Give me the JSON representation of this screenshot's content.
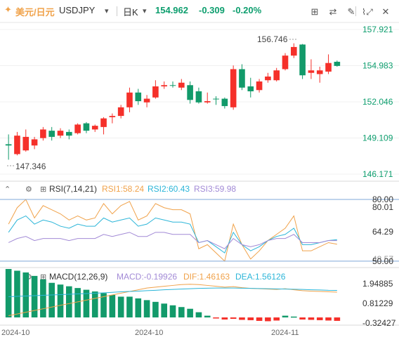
{
  "header": {
    "symbol_cn": "美元/日元",
    "symbol": "USDJPY",
    "symbol_caret": "▾",
    "period": "日K",
    "period_caret": "▾",
    "price": "154.962",
    "change": "-0.309",
    "change_pct": "-0.20%",
    "icons": [
      "draw-icon",
      "compare-icon",
      "pen-icon",
      "brush-icon",
      "expand-icon",
      "close-icon"
    ]
  },
  "colors": {
    "up": "#f5302a",
    "down": "#129a6a",
    "price_axis": "#0d9e6e",
    "rsi1": "#f0a24a",
    "rsi2": "#2bb5d8",
    "rsi3": "#a28ad6",
    "macd": "#f0a24a",
    "dea": "#2bb5d8",
    "ref_line": "#7fa8d8"
  },
  "chart_data": [
    {
      "type": "candlestick",
      "title": "",
      "y_ticks": [
        "157.921",
        "154.983",
        "152.046",
        "149.109",
        "146.171"
      ],
      "ylim": [
        146.171,
        157.921
      ],
      "high_label": "156.746",
      "low_label": "147.346",
      "candles": [
        {
          "o": 148.6,
          "h": 149.4,
          "l": 147.346,
          "c": 148.5
        },
        {
          "o": 147.8,
          "h": 149.6,
          "l": 147.7,
          "c": 149.3
        },
        {
          "o": 148.1,
          "h": 149.8,
          "l": 148.0,
          "c": 149.2
        },
        {
          "o": 148.5,
          "h": 149.2,
          "l": 148.2,
          "c": 149.0
        },
        {
          "o": 149.1,
          "h": 150.0,
          "l": 148.9,
          "c": 149.8
        },
        {
          "o": 149.7,
          "h": 150.0,
          "l": 148.9,
          "c": 149.2
        },
        {
          "o": 149.3,
          "h": 149.9,
          "l": 149.1,
          "c": 149.7
        },
        {
          "o": 149.6,
          "h": 149.8,
          "l": 149.0,
          "c": 149.3
        },
        {
          "o": 149.5,
          "h": 150.3,
          "l": 149.4,
          "c": 150.2
        },
        {
          "o": 150.3,
          "h": 150.4,
          "l": 149.5,
          "c": 149.7
        },
        {
          "o": 149.8,
          "h": 150.2,
          "l": 149.6,
          "c": 150.1
        },
        {
          "o": 150.0,
          "h": 150.8,
          "l": 149.4,
          "c": 150.7
        },
        {
          "o": 150.8,
          "h": 151.1,
          "l": 150.3,
          "c": 150.9
        },
        {
          "o": 150.9,
          "h": 151.8,
          "l": 150.7,
          "c": 151.6
        },
        {
          "o": 151.6,
          "h": 153.2,
          "l": 151.2,
          "c": 152.8
        },
        {
          "o": 152.8,
          "h": 153.1,
          "l": 151.8,
          "c": 152.1
        },
        {
          "o": 152.0,
          "h": 152.6,
          "l": 151.6,
          "c": 152.3
        },
        {
          "o": 152.4,
          "h": 153.8,
          "l": 152.3,
          "c": 153.3
        },
        {
          "o": 153.3,
          "h": 153.7,
          "l": 153.1,
          "c": 153.4
        },
        {
          "o": 153.4,
          "h": 153.7,
          "l": 153.2,
          "c": 153.35
        },
        {
          "o": 153.2,
          "h": 153.9,
          "l": 153.0,
          "c": 153.6
        },
        {
          "o": 153.4,
          "h": 153.7,
          "l": 151.9,
          "c": 152.2
        },
        {
          "o": 152.9,
          "h": 153.2,
          "l": 151.9,
          "c": 152.0
        },
        {
          "o": 152.0,
          "h": 152.8,
          "l": 151.9,
          "c": 152.1
        },
        {
          "o": 152.3,
          "h": 152.5,
          "l": 151.8,
          "c": 152.25
        },
        {
          "o": 152.3,
          "h": 152.4,
          "l": 151.5,
          "c": 151.7
        },
        {
          "o": 151.6,
          "h": 155.0,
          "l": 151.4,
          "c": 154.7
        },
        {
          "o": 154.7,
          "h": 155.1,
          "l": 153.0,
          "c": 153.2
        },
        {
          "o": 153.3,
          "h": 154.0,
          "l": 152.4,
          "c": 152.9
        },
        {
          "o": 153.0,
          "h": 153.9,
          "l": 152.8,
          "c": 153.7
        },
        {
          "o": 153.8,
          "h": 154.4,
          "l": 153.6,
          "c": 154.1
        },
        {
          "o": 153.8,
          "h": 154.8,
          "l": 153.7,
          "c": 154.6
        },
        {
          "o": 154.7,
          "h": 156.0,
          "l": 154.6,
          "c": 155.8
        },
        {
          "o": 155.8,
          "h": 156.8,
          "l": 155.6,
          "c": 156.5
        },
        {
          "o": 156.7,
          "h": 156.746,
          "l": 153.9,
          "c": 154.2
        },
        {
          "o": 154.4,
          "h": 155.5,
          "l": 153.9,
          "c": 154.6
        },
        {
          "o": 154.3,
          "h": 154.9,
          "l": 153.6,
          "c": 154.6
        },
        {
          "o": 154.5,
          "h": 155.9,
          "l": 154.3,
          "c": 155.2
        },
        {
          "o": 155.3,
          "h": 155.4,
          "l": 154.9,
          "c": 154.962
        }
      ]
    },
    {
      "type": "line",
      "title": "RSI(7,14,21)",
      "legend": [
        {
          "label": "RSI1:58.24",
          "color": "#f0a24a"
        },
        {
          "label": "RSI2:60.43",
          "color": "#2bb5d8"
        },
        {
          "label": "RSI3:59.98",
          "color": "#a28ad6"
        }
      ],
      "y_ticks": [
        "80.01",
        "64.29"
      ],
      "ref_labels": [
        "80.00",
        "48.57",
        "50.00"
      ],
      "ref_values": [
        80,
        50
      ],
      "ylim": [
        48.57,
        80.01
      ],
      "series": [
        {
          "name": "RSI1",
          "values": [
            68,
            76,
            80,
            71,
            77,
            75,
            73,
            70,
            72,
            70,
            71,
            78,
            73,
            77,
            79,
            70,
            72,
            78,
            76,
            75,
            75,
            73,
            56,
            58,
            54,
            50,
            68,
            58,
            51,
            55,
            60,
            63,
            66,
            72,
            55,
            55,
            57,
            59,
            58.24
          ]
        },
        {
          "name": "RSI2",
          "values": [
            64,
            70,
            72,
            68,
            70,
            69,
            67,
            66,
            68,
            67,
            67,
            71,
            69,
            70,
            71,
            67,
            68,
            71,
            70,
            69,
            69,
            68,
            59,
            60,
            57,
            54,
            64,
            58,
            55,
            57,
            60,
            62,
            63,
            66,
            58,
            58,
            59,
            60,
            60.43
          ]
        },
        {
          "name": "RSI3",
          "values": [
            59,
            61,
            62,
            60,
            61,
            61,
            61,
            60,
            61,
            61,
            61,
            63,
            62,
            63,
            64,
            62,
            62,
            64,
            64,
            63,
            63,
            63,
            59,
            60,
            58,
            56,
            61,
            58,
            57,
            58,
            60,
            61,
            61,
            63,
            59,
            59,
            59,
            60,
            59.98
          ]
        }
      ]
    },
    {
      "type": "bar",
      "title": "MACD(12,26,9)",
      "legend": [
        {
          "label": "MACD:-0.19926",
          "color": "#f0a24a"
        },
        {
          "label": "DIF:1.46163",
          "color": "#f0a24a"
        },
        {
          "label": "DEA:1.56126",
          "color": "#2bb5d8"
        }
      ],
      "y_ticks": [
        "1.94885",
        "0.81229",
        "-0.32427"
      ],
      "ylim": [
        -0.32427,
        1.94885
      ],
      "histogram": [
        2.8,
        2.7,
        2.6,
        2.4,
        2.2,
        2.0,
        1.9,
        1.8,
        1.7,
        1.6,
        1.5,
        1.4,
        1.3,
        1.2,
        1.2,
        1.1,
        1.0,
        0.9,
        0.8,
        0.7,
        0.6,
        0.5,
        0.3,
        0.1,
        -0.05,
        -0.12,
        -0.08,
        -0.14,
        -0.16,
        -0.2,
        -0.22,
        -0.18,
        0.1,
        0.05,
        -0.12,
        -0.14,
        -0.16,
        -0.18,
        -0.19926
      ],
      "dif": [
        0.1,
        0.2,
        0.3,
        0.4,
        0.5,
        0.6,
        0.7,
        0.8,
        0.9,
        1.0,
        1.1,
        1.2,
        1.3,
        1.4,
        1.5,
        1.6,
        1.7,
        1.75,
        1.8,
        1.85,
        1.9,
        1.92,
        1.9,
        1.85,
        1.8,
        1.75,
        1.78,
        1.72,
        1.68,
        1.66,
        1.64,
        1.62,
        1.66,
        1.6,
        1.55,
        1.52,
        1.5,
        1.48,
        1.46163
      ],
      "dea": [
        1.2,
        1.22,
        1.24,
        1.26,
        1.28,
        1.3,
        1.32,
        1.34,
        1.36,
        1.38,
        1.4,
        1.42,
        1.45,
        1.48,
        1.5,
        1.52,
        1.55,
        1.57,
        1.6,
        1.62,
        1.64,
        1.66,
        1.68,
        1.69,
        1.7,
        1.7,
        1.7,
        1.69,
        1.68,
        1.67,
        1.66,
        1.65,
        1.64,
        1.63,
        1.62,
        1.6,
        1.59,
        1.57,
        1.56126
      ]
    }
  ],
  "x_labels": [
    "2024-10",
    "2024-10",
    "2024-11"
  ]
}
